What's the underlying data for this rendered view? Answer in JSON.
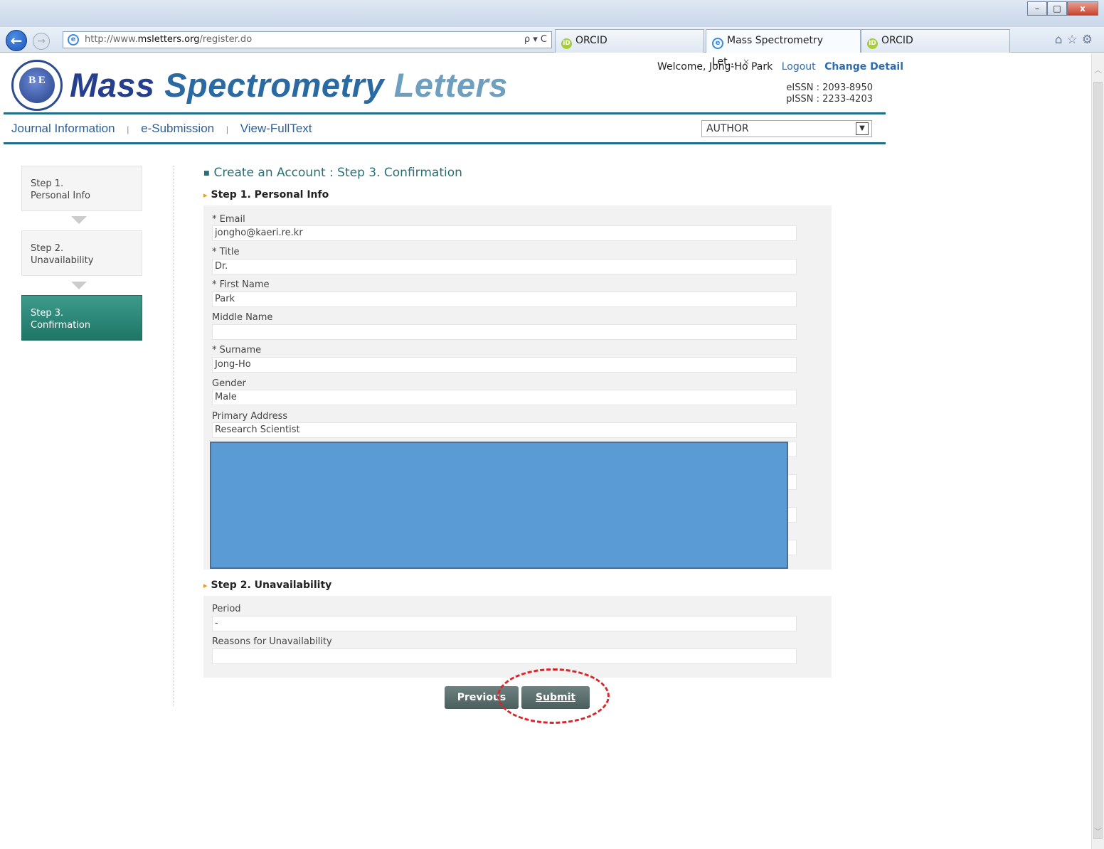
{
  "browser": {
    "url_prefix": "http://www.",
    "url_domain": "msletters.org",
    "url_path": "/register.do",
    "address_tools": "ρ ▾ C",
    "tabs": [
      {
        "label": "ORCID"
      },
      {
        "label": "Mass Spectrometry Let..."
      },
      {
        "label": "ORCID"
      }
    ],
    "tab_close": "×",
    "window": {
      "minimize": "–",
      "maximize": "□",
      "close": "x"
    },
    "toolbar_icons": "⌂☆⚙"
  },
  "header": {
    "logo_glyph": "B E",
    "title_part1": "Mass ",
    "title_part2": "Spectrometry ",
    "title_part3": "Letters",
    "welcome": "Welcome, Jong-Ho Park",
    "logout": "Logout",
    "change_detail": "Change Detail",
    "eissn": "eISSN : 2093-8950",
    "pissn": "pISSN : 2233-4203"
  },
  "menu": {
    "items": [
      "Journal Information",
      "e-Submission",
      "View-FullText"
    ],
    "separator": "|",
    "role_selected": "AUTHOR"
  },
  "steps": [
    {
      "line1": "Step 1.",
      "line2": "Personal Info"
    },
    {
      "line1": "Step 2.",
      "line2": "Unavailability"
    },
    {
      "line1": "Step 3.",
      "line2": "Confirmation"
    }
  ],
  "page_title": "Create an Account : Step 3. Confirmation",
  "section1": {
    "title": "Step 1. Personal Info",
    "fields": [
      {
        "label": "* Email",
        "value": "jongho@kaeri.re.kr"
      },
      {
        "label": "* Title",
        "value": "Dr."
      },
      {
        "label": "* First Name",
        "value": "Park"
      },
      {
        "label": "Middle Name",
        "value": ""
      },
      {
        "label": "* Surname",
        "value": "Jong-Ho"
      },
      {
        "label": "Gender",
        "value": "Male"
      },
      {
        "label": "Primary Address",
        "value": "Research Scientist"
      }
    ]
  },
  "section2": {
    "title": "Step 2. Unavailability",
    "fields": [
      {
        "label": "Period",
        "value": "-"
      },
      {
        "label": "Reasons for Unavailability",
        "value": ""
      }
    ]
  },
  "buttons": {
    "previous": "Previous",
    "submit": "Submit"
  },
  "colors": {
    "accent_teal": "#1f6e8c",
    "step_active": "#2a8676",
    "redaction": "#5b9bd5",
    "callout": "#d9262a"
  }
}
